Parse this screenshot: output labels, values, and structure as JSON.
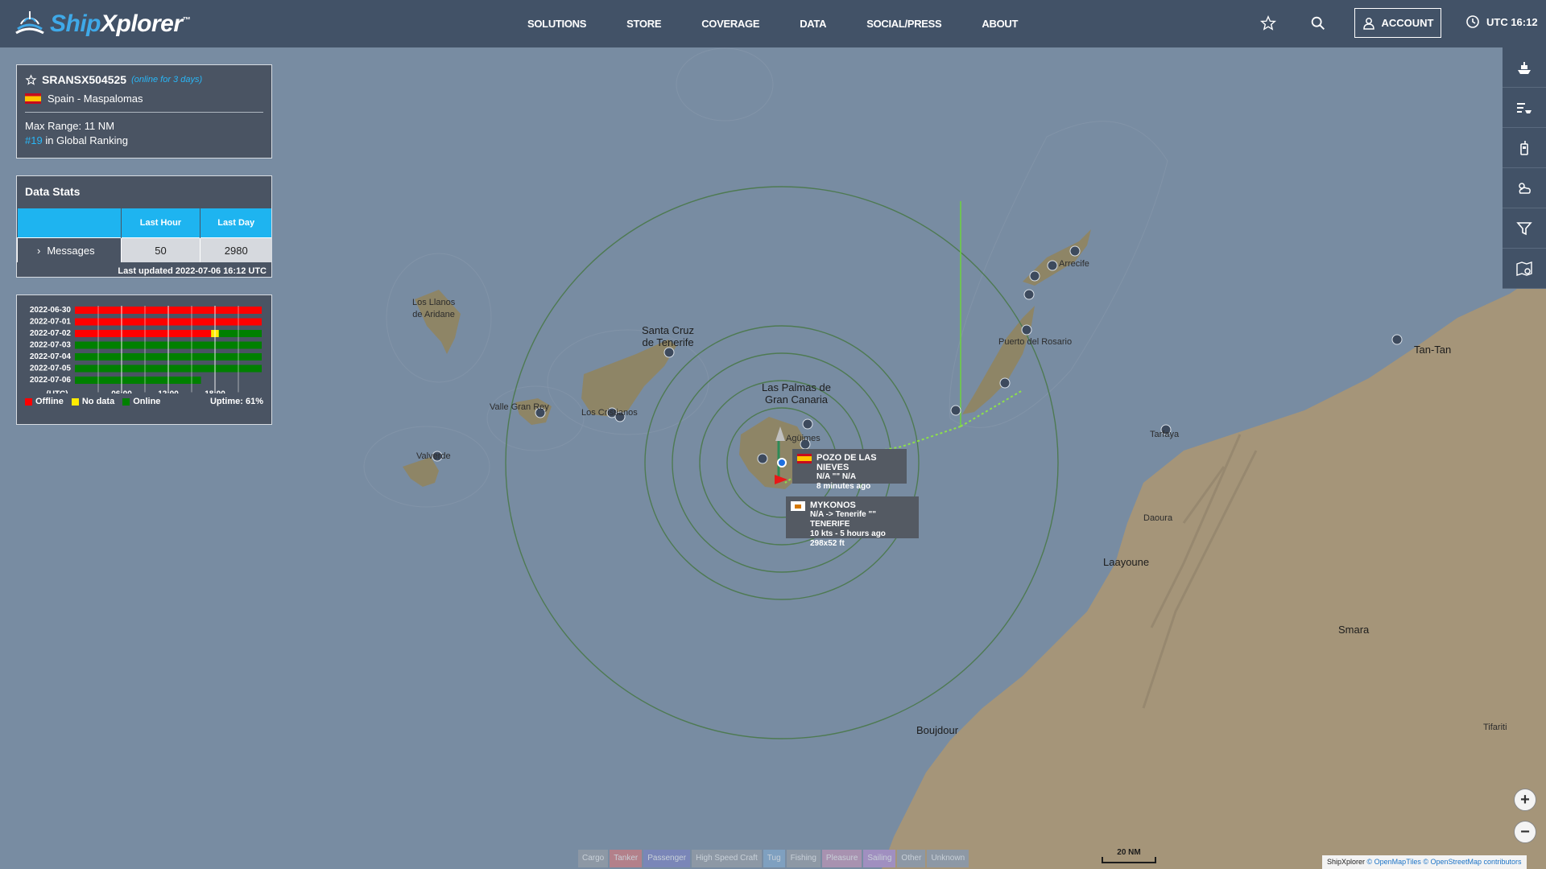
{
  "app": {
    "brand_ship": "Ship",
    "brand_xplorer": "Xplorer",
    "brand_tm": "™"
  },
  "nav": {
    "items": [
      "SOLUTIONS",
      "STORE",
      "COVERAGE",
      "DATA",
      "SOCIAL/PRESS",
      "ABOUT"
    ],
    "account_label": "ACCOUNT",
    "utc_label": "UTC 16:12"
  },
  "station": {
    "id": "SRANSX504525",
    "online_note": "(online for 3 days)",
    "location": "Spain - Maspalomas",
    "max_range": "Max Range: 11 NM",
    "rank_num": "#19",
    "rank_text": " in Global Ranking"
  },
  "stats": {
    "title": "Data Stats",
    "col_last_hour": "Last Hour",
    "col_last_day": "Last Day",
    "row_label": "Messages",
    "last_hour_value": "50",
    "last_day_value": "2980",
    "updated": "Last updated 2022-07-06 16:12 UTC"
  },
  "uptime": {
    "dates": [
      "2022-06-30",
      "2022-07-01",
      "2022-07-02",
      "2022-07-03",
      "2022-07-04",
      "2022-07-05",
      "2022-07-06"
    ],
    "axis_labels": [
      "(UTC)",
      "06:00",
      "12:00",
      "18:00"
    ],
    "legend_offline": "Offline",
    "legend_nodata": "No data",
    "legend_online": "Online",
    "uptime_text": "Uptime: 61%",
    "colors": {
      "offline": "#ff0000",
      "nodata": "#ffeb00",
      "online": "#008000"
    },
    "segments": [
      [
        [
          0,
          24,
          "offline"
        ]
      ],
      [
        [
          0,
          24,
          "offline"
        ]
      ],
      [
        [
          0,
          17.5,
          "offline"
        ],
        [
          17.5,
          18.5,
          "nodata"
        ],
        [
          18.5,
          24,
          "online"
        ]
      ],
      [
        [
          0,
          24,
          "online"
        ]
      ],
      [
        [
          0,
          24,
          "online"
        ]
      ],
      [
        [
          0,
          24,
          "online"
        ]
      ],
      [
        [
          0,
          16.2,
          "online"
        ]
      ]
    ]
  },
  "vessels": {
    "v1": {
      "name": "POZO DE LAS NIEVES",
      "route": "N/A \"\" N/A",
      "age": "8 minutes ago"
    },
    "v2": {
      "name": "MYKONOS",
      "route": "N/A -> Tenerife \"\" TENERIFE",
      "speed": "10 kts - 5 hours ago",
      "dims": "298x52 ft"
    }
  },
  "map_labels": {
    "santa_cruz": "Santa Cruz\nde Tenerife",
    "las_palmas": "Las Palmas de\nGran Canaria",
    "los_llanos": "Los Llanos\nde Aridane",
    "valle_gran_rey": "Valle Gran Rey",
    "los_cristianos": "Los Cristianos",
    "valverde": "Valverde",
    "arrecife": "Arrecife",
    "puerto_del_rosario": "Puerto del Rosario",
    "tan_tan": "Tan-Tan",
    "tarfaya": "Tarfaya",
    "daoura": "Daoura",
    "laayoune": "Laayoune",
    "smara": "Smara",
    "boujdour": "Boujdour",
    "tifariti": "Tifariti",
    "agaete": "Agüimes"
  },
  "filters": [
    "Cargo",
    "Tanker",
    "Passenger",
    "High Speed Craft",
    "Tug",
    "Fishing",
    "Pleasure",
    "Sailing",
    "Other",
    "Unknown"
  ],
  "scale_label": "20 NM",
  "attribution": {
    "brand": "ShipXplorer",
    "c1": " © OpenMapTiles",
    "c2": " © OpenStreetMap contributors"
  },
  "icons": {
    "star": "star-icon",
    "search": "search-icon",
    "account": "user-icon",
    "clock": "clock-icon",
    "tools": [
      "ship-icon",
      "ship-list-icon",
      "radio-icon",
      "weather-icon",
      "filter-icon",
      "map-settings-icon"
    ]
  }
}
